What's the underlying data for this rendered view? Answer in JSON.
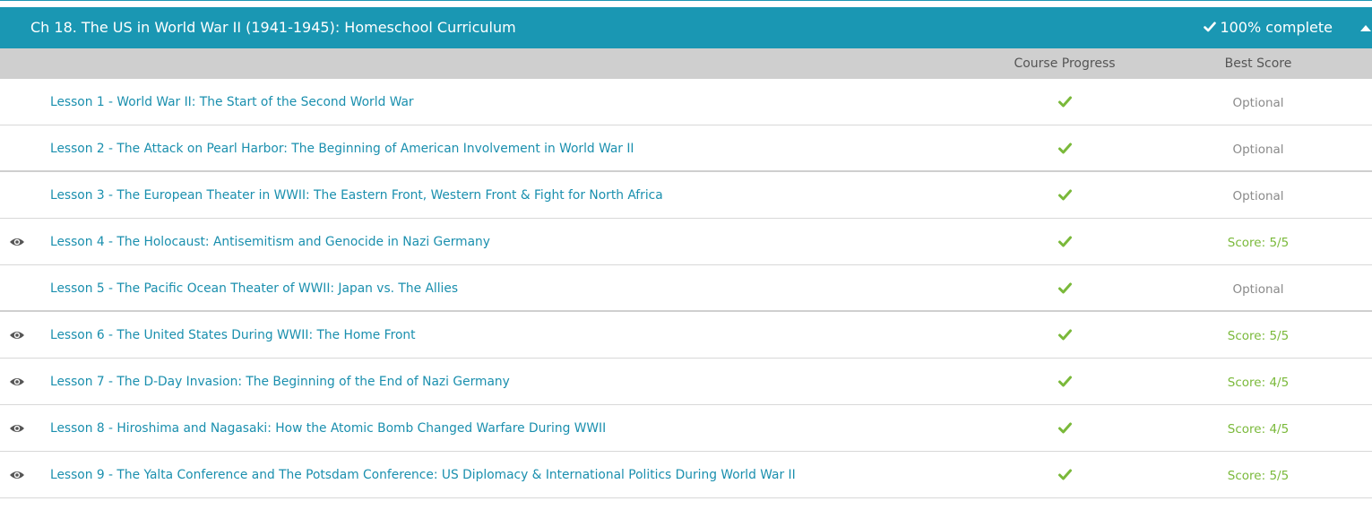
{
  "chapter": {
    "title": "Ch 18. The US in World War II (1941-1945): Homeschool Curriculum",
    "status": "100% complete",
    "header_color": "#1a97b3"
  },
  "columns": {
    "progress": "Course Progress",
    "score": "Best Score"
  },
  "colors": {
    "link": "#1a8fae",
    "check": "#7ab93a",
    "optional": "#8a8a8a",
    "score": "#7ab93a"
  },
  "lessons": [
    {
      "title": "Lesson 1 - World War II: The Start of the Second World War",
      "complete": true,
      "viewed": false,
      "score": "Optional"
    },
    {
      "title": "Lesson 2 - The Attack on Pearl Harbor: The Beginning of American Involvement in World War II",
      "complete": true,
      "viewed": false,
      "score": "Optional"
    },
    {
      "title": "Lesson 3 - The European Theater in WWII: The Eastern Front, Western Front & Fight for North Africa",
      "complete": true,
      "viewed": false,
      "score": "Optional"
    },
    {
      "title": "Lesson 4 - The Holocaust: Antisemitism and Genocide in Nazi Germany",
      "complete": true,
      "viewed": true,
      "score": "Score: 5/5"
    },
    {
      "title": "Lesson 5 - The Pacific Ocean Theater of WWII: Japan vs. The Allies",
      "complete": true,
      "viewed": false,
      "score": "Optional"
    },
    {
      "title": "Lesson 6 - The United States During WWII: The Home Front",
      "complete": true,
      "viewed": true,
      "score": "Score: 5/5"
    },
    {
      "title": "Lesson 7 - The D-Day Invasion: The Beginning of the End of Nazi Germany",
      "complete": true,
      "viewed": true,
      "score": "Score: 4/5"
    },
    {
      "title": "Lesson 8 - Hiroshima and Nagasaki: How the Atomic Bomb Changed Warfare During WWII",
      "complete": true,
      "viewed": true,
      "score": "Score: 4/5"
    },
    {
      "title": "Lesson 9 - The Yalta Conference and The Potsdam Conference: US Diplomacy & International Politics During World War II",
      "complete": true,
      "viewed": true,
      "score": "Score: 5/5"
    }
  ]
}
